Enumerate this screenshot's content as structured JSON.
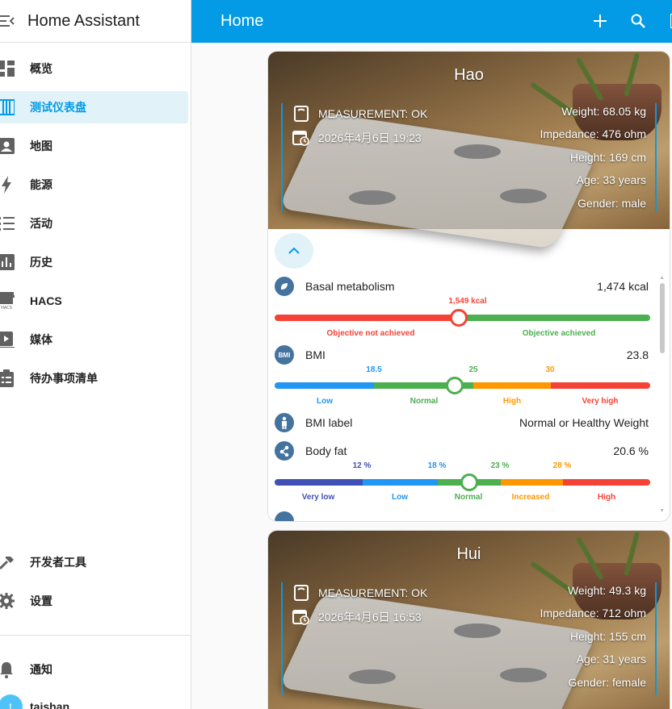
{
  "app": {
    "title": "Home Assistant"
  },
  "sidebar": {
    "items": [
      {
        "label": "概览",
        "icon": "dashboard-icon"
      },
      {
        "label": "测试仪表盘",
        "icon": "view-column-icon"
      },
      {
        "label": "地图",
        "icon": "account-box-icon"
      },
      {
        "label": "能源",
        "icon": "lightning-bolt-icon"
      },
      {
        "label": "活动",
        "icon": "format-list-icon"
      },
      {
        "label": "历史",
        "icon": "chart-box-icon"
      },
      {
        "label": "HACS",
        "icon": "hacs-icon"
      },
      {
        "label": "媒体",
        "icon": "play-box-icon"
      },
      {
        "label": "待办事项清单",
        "icon": "clipboard-list-icon"
      }
    ],
    "bottom_items": [
      {
        "label": "开发者工具",
        "icon": "hammer-icon"
      },
      {
        "label": "设置",
        "icon": "cog-icon"
      }
    ],
    "notifications": {
      "label": "通知",
      "icon": "bell-icon"
    },
    "user": {
      "name": "taishan",
      "avatar_initial": "t"
    }
  },
  "topbar": {
    "title": "Home"
  },
  "cards": [
    {
      "name": "Hao",
      "status": "MEASUREMENT: OK",
      "timestamp": "2026年4月6日 19:23",
      "metrics": [
        "Weight: 68.05 kg",
        "Impedance: 476 ohm",
        "Height: 169 cm",
        "Age: 33 years",
        "Gender: male"
      ],
      "attributes": {
        "basal": {
          "name": "Basal metabolism",
          "value": "1,474 kcal",
          "marker": "1,549 kcal",
          "low_label": "Objective not achieved",
          "high_label": "Objective achieved"
        },
        "bmi": {
          "name": "BMI",
          "value": "23.8",
          "ticks": [
            "18.5",
            "25",
            "30"
          ],
          "labels": [
            "Low",
            "Normal",
            "High",
            "Very high"
          ]
        },
        "bmi_label": {
          "name": "BMI label",
          "value": "Normal or Healthy Weight"
        },
        "body_fat": {
          "name": "Body fat",
          "value": "20.6 %",
          "ticks": [
            "12 %",
            "18 %",
            "23 %",
            "28 %"
          ],
          "labels": [
            "Very low",
            "Low",
            "Normal",
            "Increased",
            "High"
          ]
        }
      }
    },
    {
      "name": "Hui",
      "status": "MEASUREMENT: OK",
      "timestamp": "2026年4月6日 16:53",
      "metrics": [
        "Weight: 49.3 kg",
        "Impedance: 712 ohm",
        "Height: 155 cm",
        "Age: 31 years",
        "Gender: female"
      ]
    }
  ],
  "colors": {
    "primary": "#039be5",
    "red": "#f44336",
    "green": "#4caf50",
    "blue": "#2196f3",
    "orange": "#ff9800",
    "indigo": "#3f51b5",
    "icon_bg": "#44739e"
  }
}
